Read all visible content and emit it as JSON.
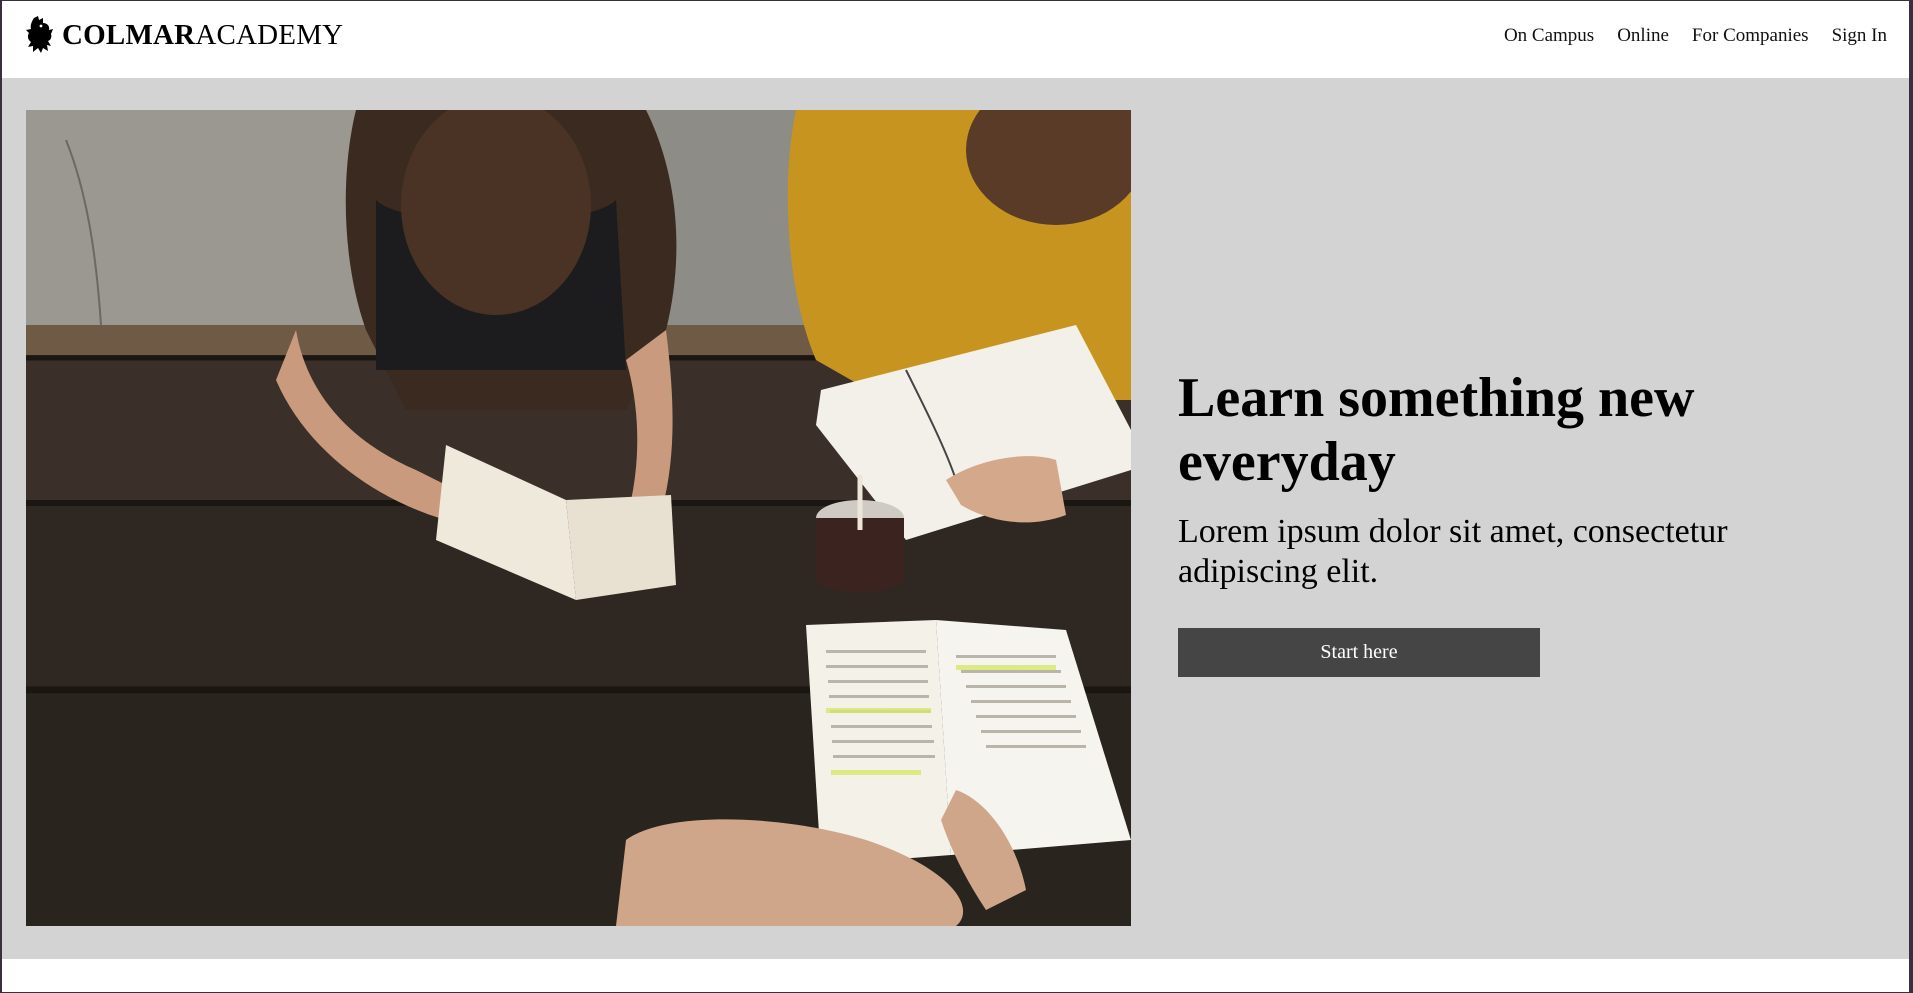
{
  "header": {
    "brand_bold": "COLMAR",
    "brand_light": "ACADEMY",
    "logo_icon": "griffin-logo-icon",
    "nav": [
      {
        "label": "On Campus"
      },
      {
        "label": "Online"
      },
      {
        "label": "For Companies"
      },
      {
        "label": "Sign In"
      }
    ]
  },
  "hero": {
    "image_icon": "students-studying-photo",
    "title": "Learn something new everyday",
    "subtitle": "Lorem ipsum dolor sit amet, consectetur adipiscing elit.",
    "cta_label": "Start here"
  },
  "colors": {
    "hero_background": "#d3d3d3",
    "cta_background": "#454545",
    "cta_text": "#ffffff"
  }
}
